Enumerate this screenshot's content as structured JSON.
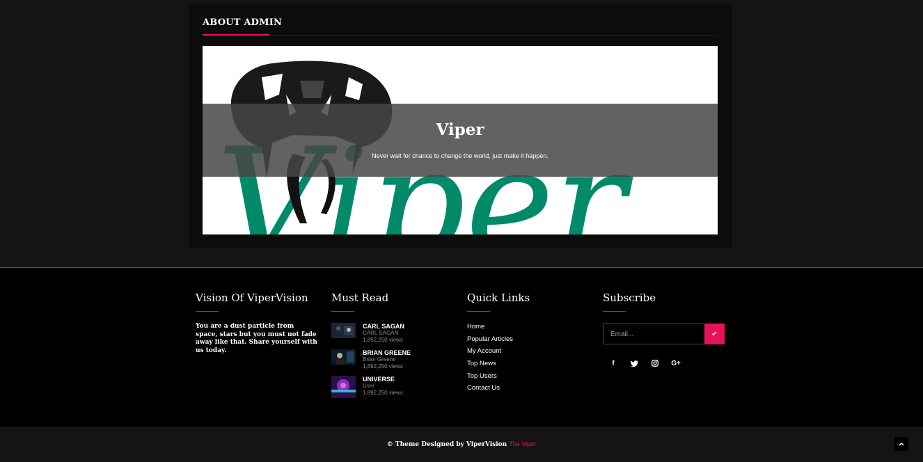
{
  "about": {
    "title": "ABOUT ADMIN",
    "name": "Viper",
    "quote": "Never wait for chance to change the world, just make it happen.",
    "logo_text": "Viper"
  },
  "footer": {
    "vision": {
      "title": "Vision Of ViperVision",
      "text": "You are a dust particle from space, stars but you must not fade away like that. Share yourself with us today."
    },
    "must_read": {
      "title": "Must Read",
      "items": [
        {
          "name": "CARL SAGAN",
          "author": "CARL SAGAN",
          "views": "1,892,250 views"
        },
        {
          "name": "BRIAN GREENE",
          "author": "Brian Greene",
          "views": "1,892,250 views"
        },
        {
          "name": "UNIVERSE",
          "author": "User",
          "views": "1,892,250 views"
        }
      ]
    },
    "quick_links": {
      "title": "Quick Links",
      "items": [
        "Home",
        "Popular Articles",
        "My Account",
        "Top News",
        "Top Users",
        "Contact Us"
      ]
    },
    "subscribe": {
      "title": "Subscribe",
      "placeholder": "Email...",
      "submit_icon": "check-icon",
      "social": [
        "facebook-icon",
        "twitter-icon",
        "instagram-icon",
        "google-plus-icon"
      ]
    }
  },
  "bottom": {
    "copyright": "© Theme Designed by ViperVision",
    "brand": "The Viper"
  },
  "colors": {
    "accent": "#e4135a",
    "logo_green": "#008a6a"
  }
}
